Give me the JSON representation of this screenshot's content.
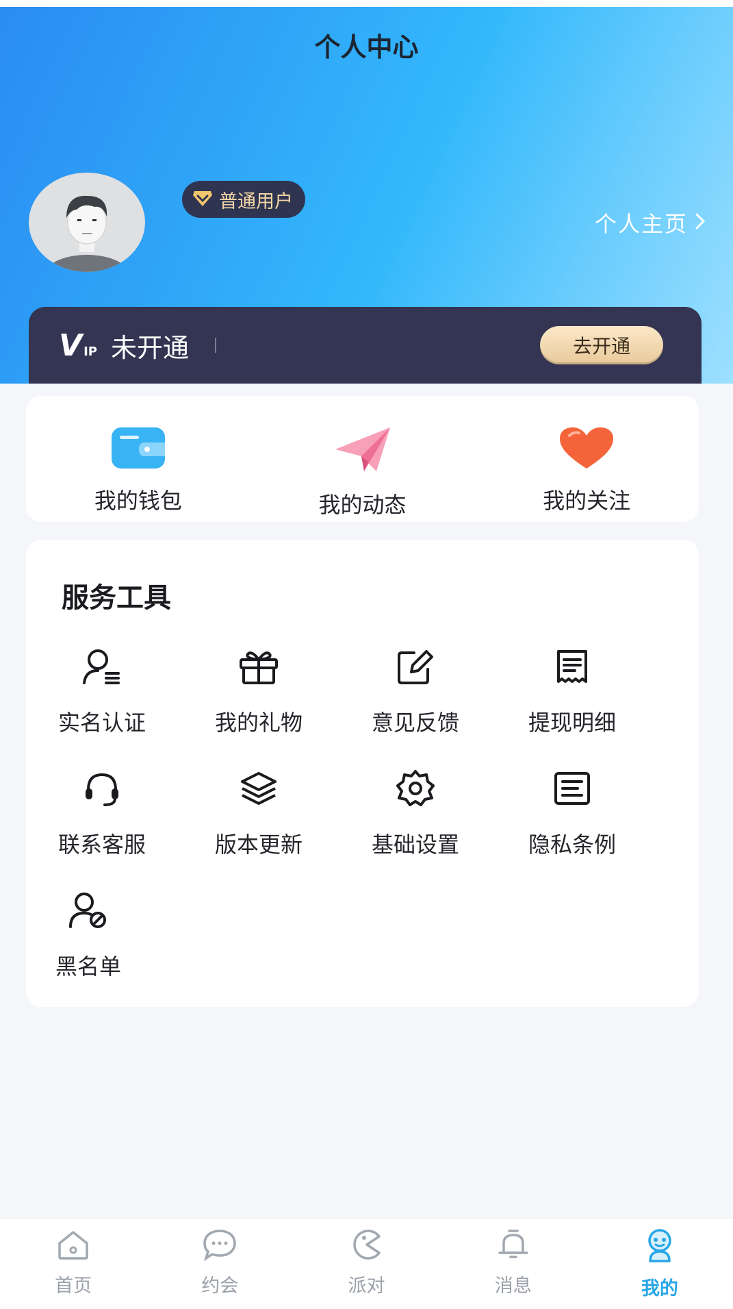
{
  "header": {
    "title": "个人中心"
  },
  "profile": {
    "badge_label": "普通用户",
    "homepage_link": "个人主页"
  },
  "vip": {
    "logo_main": "V",
    "logo_sub": "IP",
    "status": "未开通",
    "button_label": "去开通"
  },
  "quick_actions": [
    {
      "label": "我的钱包",
      "icon": "wallet-icon"
    },
    {
      "label": "我的动态",
      "icon": "paper-plane-icon"
    },
    {
      "label": "我的关注",
      "icon": "heart-icon"
    }
  ],
  "tools": {
    "title": "服务工具",
    "items": [
      {
        "label": "实名认证",
        "icon": "user-verify-icon"
      },
      {
        "label": "我的礼物",
        "icon": "gift-icon"
      },
      {
        "label": "意见反馈",
        "icon": "edit-icon"
      },
      {
        "label": "提现明细",
        "icon": "receipt-icon"
      },
      {
        "label": "联系客服",
        "icon": "headset-icon"
      },
      {
        "label": "版本更新",
        "icon": "layers-icon"
      },
      {
        "label": "基础设置",
        "icon": "gear-icon"
      },
      {
        "label": "隐私条例",
        "icon": "document-icon"
      },
      {
        "label": "黑名单",
        "icon": "user-block-icon"
      }
    ]
  },
  "tabbar": {
    "active_color": "#28a6e6",
    "items": [
      {
        "label": "首页",
        "icon": "home-icon",
        "active": false
      },
      {
        "label": "约会",
        "icon": "chat-bubble-icon",
        "active": false
      },
      {
        "label": "派对",
        "icon": "party-icon",
        "active": false
      },
      {
        "label": "消息",
        "icon": "bell-icon",
        "active": false
      },
      {
        "label": "我的",
        "icon": "profile-face-icon",
        "active": true
      }
    ]
  }
}
